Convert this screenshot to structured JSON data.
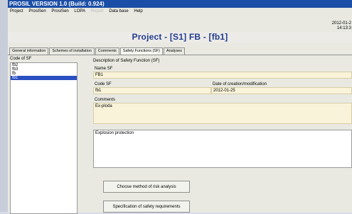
{
  "window": {
    "title": "PROSIL VERSION 1.0 (Build: 0.924)"
  },
  "menu": {
    "items": [
      {
        "label": "Project",
        "enabled": true
      },
      {
        "label": "ProsiSen",
        "enabled": true
      },
      {
        "label": "ProsiSen",
        "enabled": true
      },
      {
        "label": "LOPA",
        "enabled": true
      },
      {
        "label": "Report",
        "enabled": false
      },
      {
        "label": "Data base",
        "enabled": true
      },
      {
        "label": "Help",
        "enabled": true
      }
    ]
  },
  "header": {
    "date": "2012-01-2",
    "time": "14:13:3",
    "project_title": "Project - [S1] FB - [fb1]"
  },
  "tabs": [
    {
      "label": "General information",
      "active": false
    },
    {
      "label": "Schemes of installation",
      "active": false
    },
    {
      "label": "Comments",
      "active": false
    },
    {
      "label": "Safety Functions (SF)",
      "active": true
    },
    {
      "label": "Analyses",
      "active": false
    }
  ],
  "sf_list": {
    "label": "Code of SF",
    "items": [
      {
        "label": "fb2",
        "selected": false
      },
      {
        "label": "fb3",
        "selected": false
      },
      {
        "label": "fb",
        "selected": false
      },
      {
        "label": "fb1",
        "selected": true
      }
    ]
  },
  "description": {
    "section_label": "Description of Safety Function (SF)",
    "name_label": "Name SF",
    "name_value": "FB1",
    "code_label": "Code SF",
    "code_value": "fb1",
    "date_label": "Date of creation/modification",
    "date_value": "2012-01-25",
    "comments_label": "Comments",
    "comments_value": "Ex-ploda",
    "protection_text": "Explosion protection"
  },
  "buttons": {
    "choose_method": "Choose method of risk analysis",
    "specification": "Specification of safety requirements"
  },
  "colors": {
    "titlebar": "#1b4ea6",
    "selection": "#2a4fc2",
    "field_bg": "#f9f3d9",
    "project_title": "#213b8f"
  }
}
